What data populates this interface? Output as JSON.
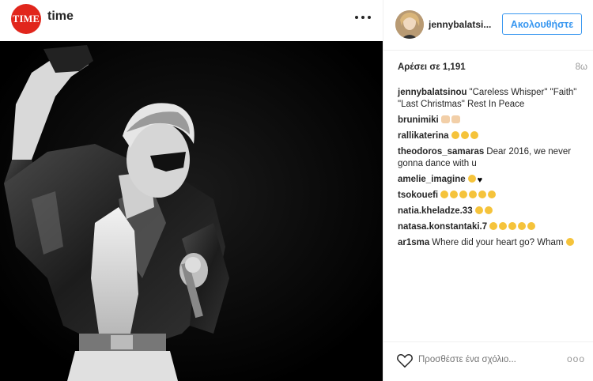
{
  "post_header": {
    "logo_text": "TIME",
    "account": "time"
  },
  "panel": {
    "username": "jennybalatsi...",
    "follow_label": "Ακολουθήστε",
    "likes": "Αρέσει σε 1,191",
    "time_ago": "8ω",
    "add_comment_placeholder": "Προσθέστε ένα σχόλιο...",
    "more": "ooo"
  },
  "comments": [
    {
      "user": "jennybalatsinou",
      "text": "\"Careless Whisper\" \"Faith\" \"Last Christmas\" Rest In Peace",
      "emojis": []
    },
    {
      "user": "brunimiki",
      "text": "",
      "emojis": [
        "folded",
        "folded"
      ]
    },
    {
      "user": "rallikaterina",
      "text": "",
      "emojis": [
        "face",
        "face",
        "face"
      ]
    },
    {
      "user": "theodoros_samaras",
      "text": "Dear 2016, we never gonna dance with u",
      "emojis": []
    },
    {
      "user": "amelie_imagine",
      "text": "",
      "emojis": [
        "face",
        "heart"
      ]
    },
    {
      "user": "tsokouefi",
      "text": "",
      "emojis": [
        "face",
        "face",
        "face",
        "face",
        "face",
        "face"
      ]
    },
    {
      "user": "natia.kheladze.33",
      "text": "",
      "emojis": [
        "face",
        "face"
      ]
    },
    {
      "user": "natasa.konstantaki.7",
      "text": "",
      "emojis": [
        "face",
        "face",
        "face",
        "face",
        "face"
      ]
    },
    {
      "user": "ar1sma",
      "text": "Where did your heart go? Wham",
      "emojis": [
        "face"
      ]
    }
  ],
  "colors": {
    "accent": "#3897f0",
    "time_red": "#e1261c",
    "text": "#262626",
    "muted": "#999999"
  },
  "icons": [
    "more-dots-icon",
    "heart-icon"
  ]
}
